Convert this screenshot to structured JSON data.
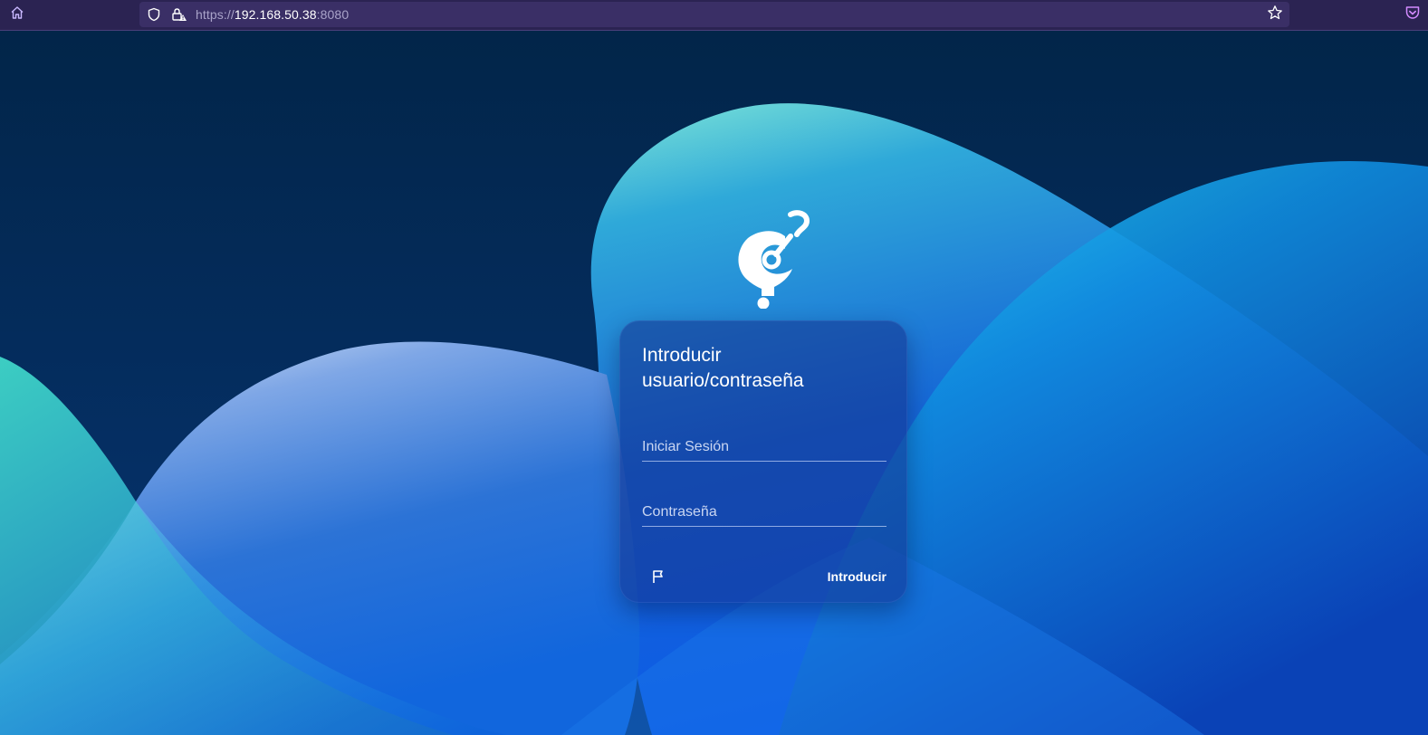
{
  "browser": {
    "url_scheme": "https://",
    "url_host": "192.168.50.38",
    "url_port": ":8080",
    "icons": {
      "home": "home-icon",
      "shield": "tracking-protection-shield-icon",
      "lock": "insecure-lock-icon",
      "bookmark": "star-icon",
      "pocket": "pocket-icon"
    }
  },
  "login": {
    "title": "Introducir usuario/contraseña",
    "username_placeholder": "Iniciar Sesión",
    "password_placeholder": "Contraseña",
    "submit_label": "Introducir",
    "language_icon": "flag-icon"
  },
  "colors": {
    "toolbar": "#2b2352",
    "urlbar": "#3a2f66",
    "card": "#14328c",
    "text": "#ffffff"
  }
}
